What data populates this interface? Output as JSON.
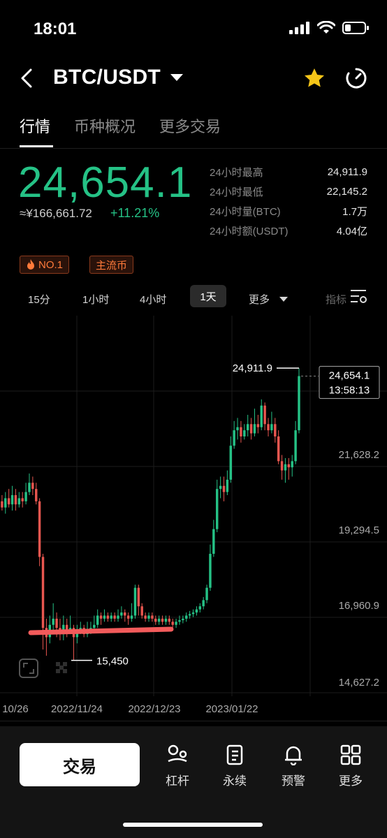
{
  "status": {
    "time": "18:01"
  },
  "nav": {
    "pair": "BTC/USDT"
  },
  "tabs": [
    "行情",
    "币种概况",
    "更多交易"
  ],
  "price": {
    "last": "24,654.1",
    "cny": "≈¥166,661.72",
    "change": "+11.21%"
  },
  "stats": [
    {
      "label": "24小时最高",
      "value": "24,911.9"
    },
    {
      "label": "24小时最低",
      "value": "22,145.2"
    },
    {
      "label": "24小时量(BTC)",
      "value": "1.7万"
    },
    {
      "label": "24小时额(USDT)",
      "value": "4.04亿"
    }
  ],
  "tags": {
    "rank": "NO.1",
    "category": "主流币"
  },
  "intervals": [
    "15分",
    "1小时",
    "4小时",
    "1天",
    "更多",
    "指标"
  ],
  "chart_data": {
    "type": "candlestick",
    "y_axis_ticks": [
      "21,628.2",
      "19,294.5",
      "16,960.9",
      "14,627.2"
    ],
    "x_axis_ticks": [
      "10/26",
      "2022/11/24",
      "2022/12/23",
      "2023/01/22"
    ],
    "high_marker": "24,911.9",
    "low_marker": "15,450",
    "last_price": "24,654.1",
    "countdown": "13:58:13",
    "ylim": [
      14627.2,
      25300
    ],
    "up_color": "#25c286",
    "down_color": "#e8564f",
    "candles": [
      [
        20500,
        20600,
        20200,
        20900
      ],
      [
        20600,
        20400,
        20300,
        20800
      ],
      [
        20400,
        20700,
        20200,
        20900
      ],
      [
        20700,
        20500,
        20400,
        21000
      ],
      [
        20500,
        20800,
        20300,
        21100
      ],
      [
        20800,
        20500,
        20300,
        21000
      ],
      [
        20500,
        20700,
        20400,
        20900
      ],
      [
        20700,
        20600,
        20400,
        20900
      ],
      [
        20600,
        20900,
        20500,
        21200
      ],
      [
        20900,
        21200,
        20800,
        21500
      ],
      [
        21200,
        21000,
        20800,
        21400
      ],
      [
        21000,
        20600,
        20500,
        21200
      ],
      [
        20600,
        18800,
        18500,
        20700
      ],
      [
        18800,
        16500,
        15800,
        18900
      ],
      [
        16500,
        16200,
        15600,
        16800
      ],
      [
        16200,
        16600,
        16000,
        16900
      ],
      [
        16600,
        16800,
        16400,
        17300
      ],
      [
        16800,
        16500,
        16200,
        17000
      ],
      [
        16500,
        16300,
        16100,
        16800
      ],
      [
        16300,
        16600,
        16100,
        16900
      ],
      [
        16600,
        16400,
        16200,
        16800
      ],
      [
        16400,
        16500,
        16300,
        16900
      ],
      [
        16500,
        16200,
        15450,
        16600
      ],
      [
        16200,
        16400,
        16000,
        16600
      ],
      [
        16400,
        16500,
        16300,
        16700
      ],
      [
        16500,
        16300,
        16200,
        16600
      ],
      [
        16300,
        16400,
        16200,
        16700
      ],
      [
        16400,
        16500,
        16300,
        16700
      ],
      [
        16500,
        16600,
        16400,
        16900
      ],
      [
        16600,
        16900,
        16500,
        17100
      ],
      [
        16900,
        16800,
        16600,
        17000
      ],
      [
        16800,
        16900,
        16700,
        17100
      ],
      [
        16900,
        16800,
        16700,
        17000
      ],
      [
        16800,
        16900,
        16700,
        17000
      ],
      [
        16900,
        16800,
        16700,
        17000
      ],
      [
        16800,
        16900,
        16700,
        17100
      ],
      [
        16900,
        17000,
        16800,
        17200
      ],
      [
        17000,
        16900,
        16700,
        17100
      ],
      [
        16900,
        16800,
        16600,
        17000
      ],
      [
        16800,
        16900,
        16700,
        17300
      ],
      [
        16900,
        17800,
        16800,
        17900
      ],
      [
        17800,
        17200,
        16900,
        17900
      ],
      [
        17200,
        16900,
        16800,
        17300
      ],
      [
        16900,
        16800,
        16700,
        17000
      ],
      [
        16800,
        16900,
        16700,
        17000
      ],
      [
        16900,
        16800,
        16700,
        17000
      ],
      [
        16800,
        16700,
        16600,
        16900
      ],
      [
        16700,
        16800,
        16600,
        16900
      ],
      [
        16800,
        16700,
        16600,
        16900
      ],
      [
        16700,
        16800,
        16600,
        16900
      ],
      [
        16800,
        16700,
        16600,
        16900
      ],
      [
        16700,
        16600,
        16500,
        16800
      ],
      [
        16600,
        16700,
        16500,
        16800
      ],
      [
        16700,
        16750,
        16600,
        16900
      ],
      [
        16750,
        16800,
        16650,
        16900
      ],
      [
        16800,
        16900,
        16700,
        17000
      ],
      [
        16900,
        16950,
        16800,
        17050
      ],
      [
        16950,
        17000,
        16850,
        17100
      ],
      [
        17000,
        17100,
        16900,
        17200
      ],
      [
        17100,
        17200,
        17000,
        17300
      ],
      [
        17200,
        17400,
        17100,
        17500
      ],
      [
        17400,
        17800,
        17300,
        17900
      ],
      [
        17800,
        18900,
        17700,
        19200
      ],
      [
        18900,
        19700,
        18800,
        20000
      ],
      [
        19700,
        21000,
        19600,
        21300
      ],
      [
        21000,
        21100,
        20700,
        21400
      ],
      [
        21100,
        20900,
        20600,
        21400
      ],
      [
        20900,
        21300,
        20800,
        21600
      ],
      [
        21300,
        22400,
        21200,
        22700
      ],
      [
        22400,
        22900,
        22300,
        23200
      ],
      [
        22900,
        23000,
        22600,
        23300
      ],
      [
        23000,
        22700,
        22500,
        23200
      ],
      [
        22700,
        22900,
        22600,
        23100
      ],
      [
        22900,
        23100,
        22700,
        23400
      ],
      [
        23100,
        22800,
        22600,
        23300
      ],
      [
        22800,
        23100,
        22700,
        23600
      ],
      [
        23100,
        23000,
        22800,
        23400
      ],
      [
        23000,
        23700,
        22900,
        23900
      ],
      [
        23700,
        23100,
        22900,
        23800
      ],
      [
        23100,
        22900,
        22700,
        23300
      ],
      [
        22900,
        23100,
        22800,
        23500
      ],
      [
        23100,
        22700,
        22500,
        23300
      ],
      [
        22700,
        21900,
        21800,
        22900
      ],
      [
        21900,
        21600,
        21300,
        22100
      ],
      [
        21600,
        21800,
        21200,
        22000
      ],
      [
        21800,
        21700,
        21300,
        22000
      ],
      [
        21700,
        21900,
        21400,
        22100
      ],
      [
        21900,
        22900,
        21800,
        23200
      ],
      [
        22900,
        24654.1,
        22800,
        24911.9
      ]
    ]
  }
}
